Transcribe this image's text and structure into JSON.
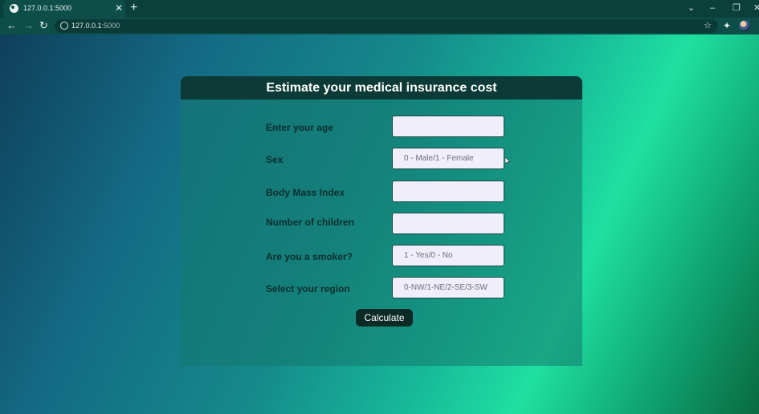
{
  "browser": {
    "tab_title": "127.0.0.1:5000",
    "url_host": "127.0.0.1",
    "url_port": ":5000"
  },
  "form": {
    "title": "Estimate your medical insurance cost",
    "fields": [
      {
        "label": "Enter your age",
        "placeholder": ""
      },
      {
        "label": "Sex",
        "placeholder": "0 - Male/1 - Female"
      },
      {
        "label": "Body Mass Index",
        "placeholder": ""
      },
      {
        "label": "Number of children",
        "placeholder": ""
      },
      {
        "label": "Are you a smoker?",
        "placeholder": "1 - Yes/0 - No"
      },
      {
        "label": "Select your region",
        "placeholder": "0-NW/1-NE/2-SE/3-SW"
      }
    ],
    "submit_label": "Calculate"
  }
}
